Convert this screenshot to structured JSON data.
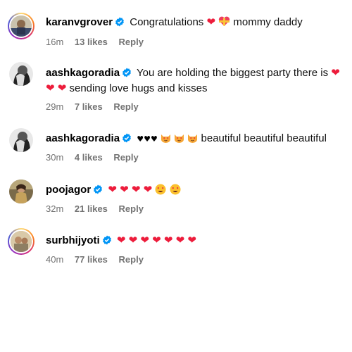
{
  "comments": [
    {
      "username": "karanvgrover",
      "text_parts": [
        "Congratulations",
        "mommy daddy"
      ],
      "time": "16m",
      "likes": "13 likes",
      "reply": "Reply"
    },
    {
      "username": "aashkagoradia",
      "text_parts": [
        "You are holding the biggest party there is",
        "sending love hugs and kisses"
      ],
      "time": "29m",
      "likes": "7 likes",
      "reply": "Reply"
    },
    {
      "username": "aashkagoradia",
      "text_parts": [
        "beautiful beautiful beautiful"
      ],
      "time": "30m",
      "likes": "4 likes",
      "reply": "Reply"
    },
    {
      "username": "poojagor",
      "text_parts": [],
      "time": "32m",
      "likes": "21 likes",
      "reply": "Reply"
    },
    {
      "username": "surbhijyoti",
      "text_parts": [],
      "time": "40m",
      "likes": "77 likes",
      "reply": "Reply"
    }
  ],
  "icons": {
    "verified": "verified-badge-icon",
    "heart": "red-heart-emoji",
    "heart_ribbon": "heart-with-ribbon-emoji",
    "black_heart": "black-heart-emoji",
    "heart_eyes_cat": "heart-eyes-cat-emoji",
    "heart_eyes_face": "heart-eyes-face-emoji"
  },
  "colors": {
    "verified_blue": "#0095f6",
    "heart_red": "#ed1c3b",
    "meta_gray": "#737373"
  }
}
